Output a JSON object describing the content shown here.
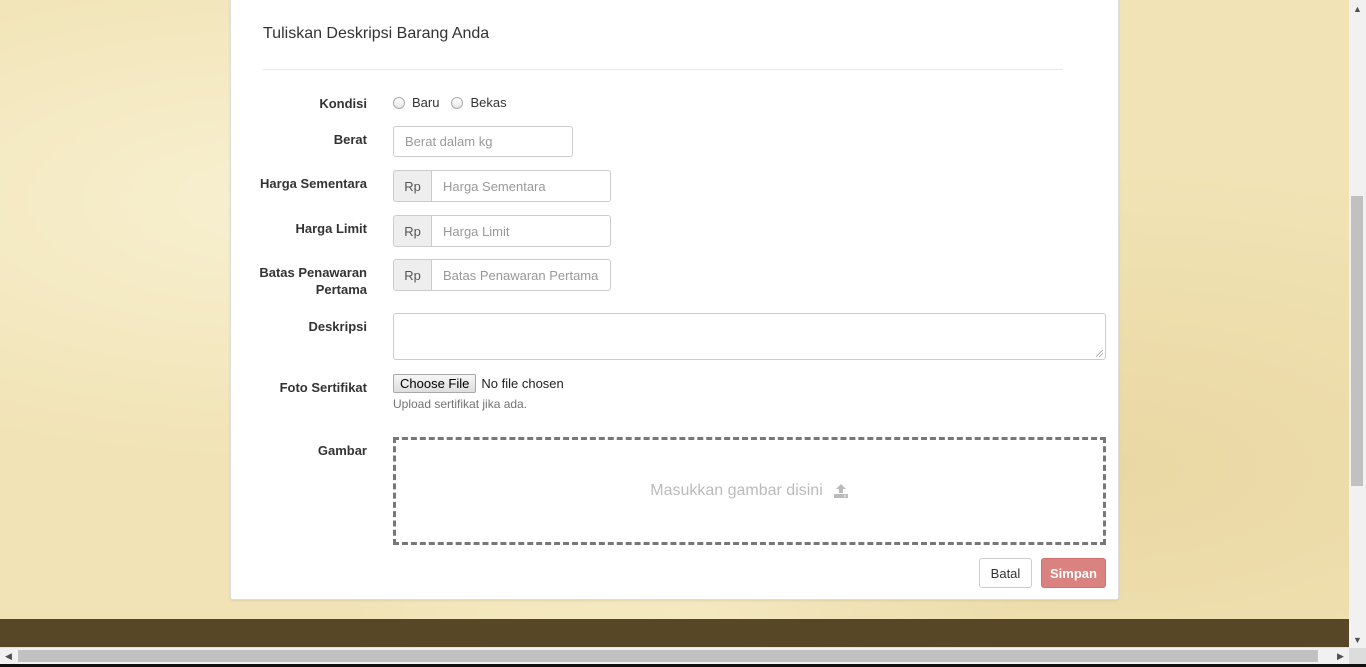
{
  "form": {
    "title": "Tuliskan Deskripsi Barang Anda",
    "kondisi": {
      "label": "Kondisi",
      "options": [
        "Baru",
        "Bekas"
      ]
    },
    "berat": {
      "label": "Berat",
      "placeholder": "Berat dalam kg"
    },
    "harga_sementara": {
      "label": "Harga Sementara",
      "addon": "Rp",
      "placeholder": "Harga Sementara"
    },
    "harga_limit": {
      "label": "Harga Limit",
      "addon": "Rp",
      "placeholder": "Harga Limit"
    },
    "batas_penawaran": {
      "label_line1": "Batas Penawaran",
      "label_line2": "Pertama",
      "addon": "Rp",
      "placeholder": "Batas Penawaran Pertama"
    },
    "deskripsi": {
      "label": "Deskripsi",
      "value": ""
    },
    "foto_sertifikat": {
      "label": "Foto Sertifikat",
      "button": "Choose File",
      "status": "No file chosen",
      "help": "Upload sertifikat jika ada."
    },
    "gambar": {
      "label": "Gambar",
      "dropzone_text": "Masukkan gambar disini",
      "icon": "upload-icon"
    },
    "buttons": {
      "batal": "Batal",
      "simpan": "Simpan"
    }
  },
  "colors": {
    "background": "#f1e3b5",
    "footer": "#574726",
    "primary_button": "#d9827f"
  }
}
